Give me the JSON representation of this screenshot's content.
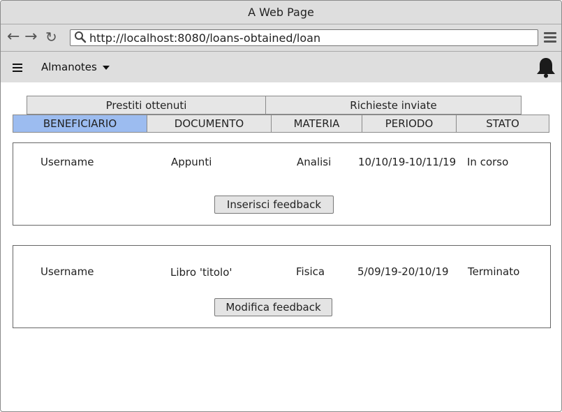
{
  "window": {
    "title": "A Web Page"
  },
  "browser": {
    "url": "http://localhost:8080/loans-obtained/loan",
    "icons": [
      "back-arrow-icon",
      "forward-arrow-icon",
      "reload-icon",
      "search-icon",
      "menu-icon"
    ]
  },
  "appbar": {
    "app_name": "Almanotes",
    "icons": [
      "hamburger-icon",
      "caret-down-icon",
      "bell-icon"
    ]
  },
  "tabs": [
    {
      "label": "Prestiti ottenuti"
    },
    {
      "label": "Richieste inviate"
    }
  ],
  "columns": [
    {
      "label": "BENEFICIARIO",
      "active": true
    },
    {
      "label": "DOCUMENTO"
    },
    {
      "label": "MATERIA"
    },
    {
      "label": "PERIODO"
    },
    {
      "label": "STATO"
    }
  ],
  "loans": [
    {
      "beneficiary": "Username",
      "document": "Appunti",
      "subject": "Analisi",
      "period": "10/10/19-10/11/19",
      "status": "In corso",
      "action": "Inserisci feedback"
    },
    {
      "beneficiary": "Username",
      "document": "Libro 'titolo'",
      "subject": "Fisica",
      "period": "5/09/19-20/10/19",
      "status": "Terminato",
      "action": "Modifica feedback"
    }
  ],
  "colors": {
    "active_column": "#9cbcf0",
    "chrome": "#dedede"
  }
}
